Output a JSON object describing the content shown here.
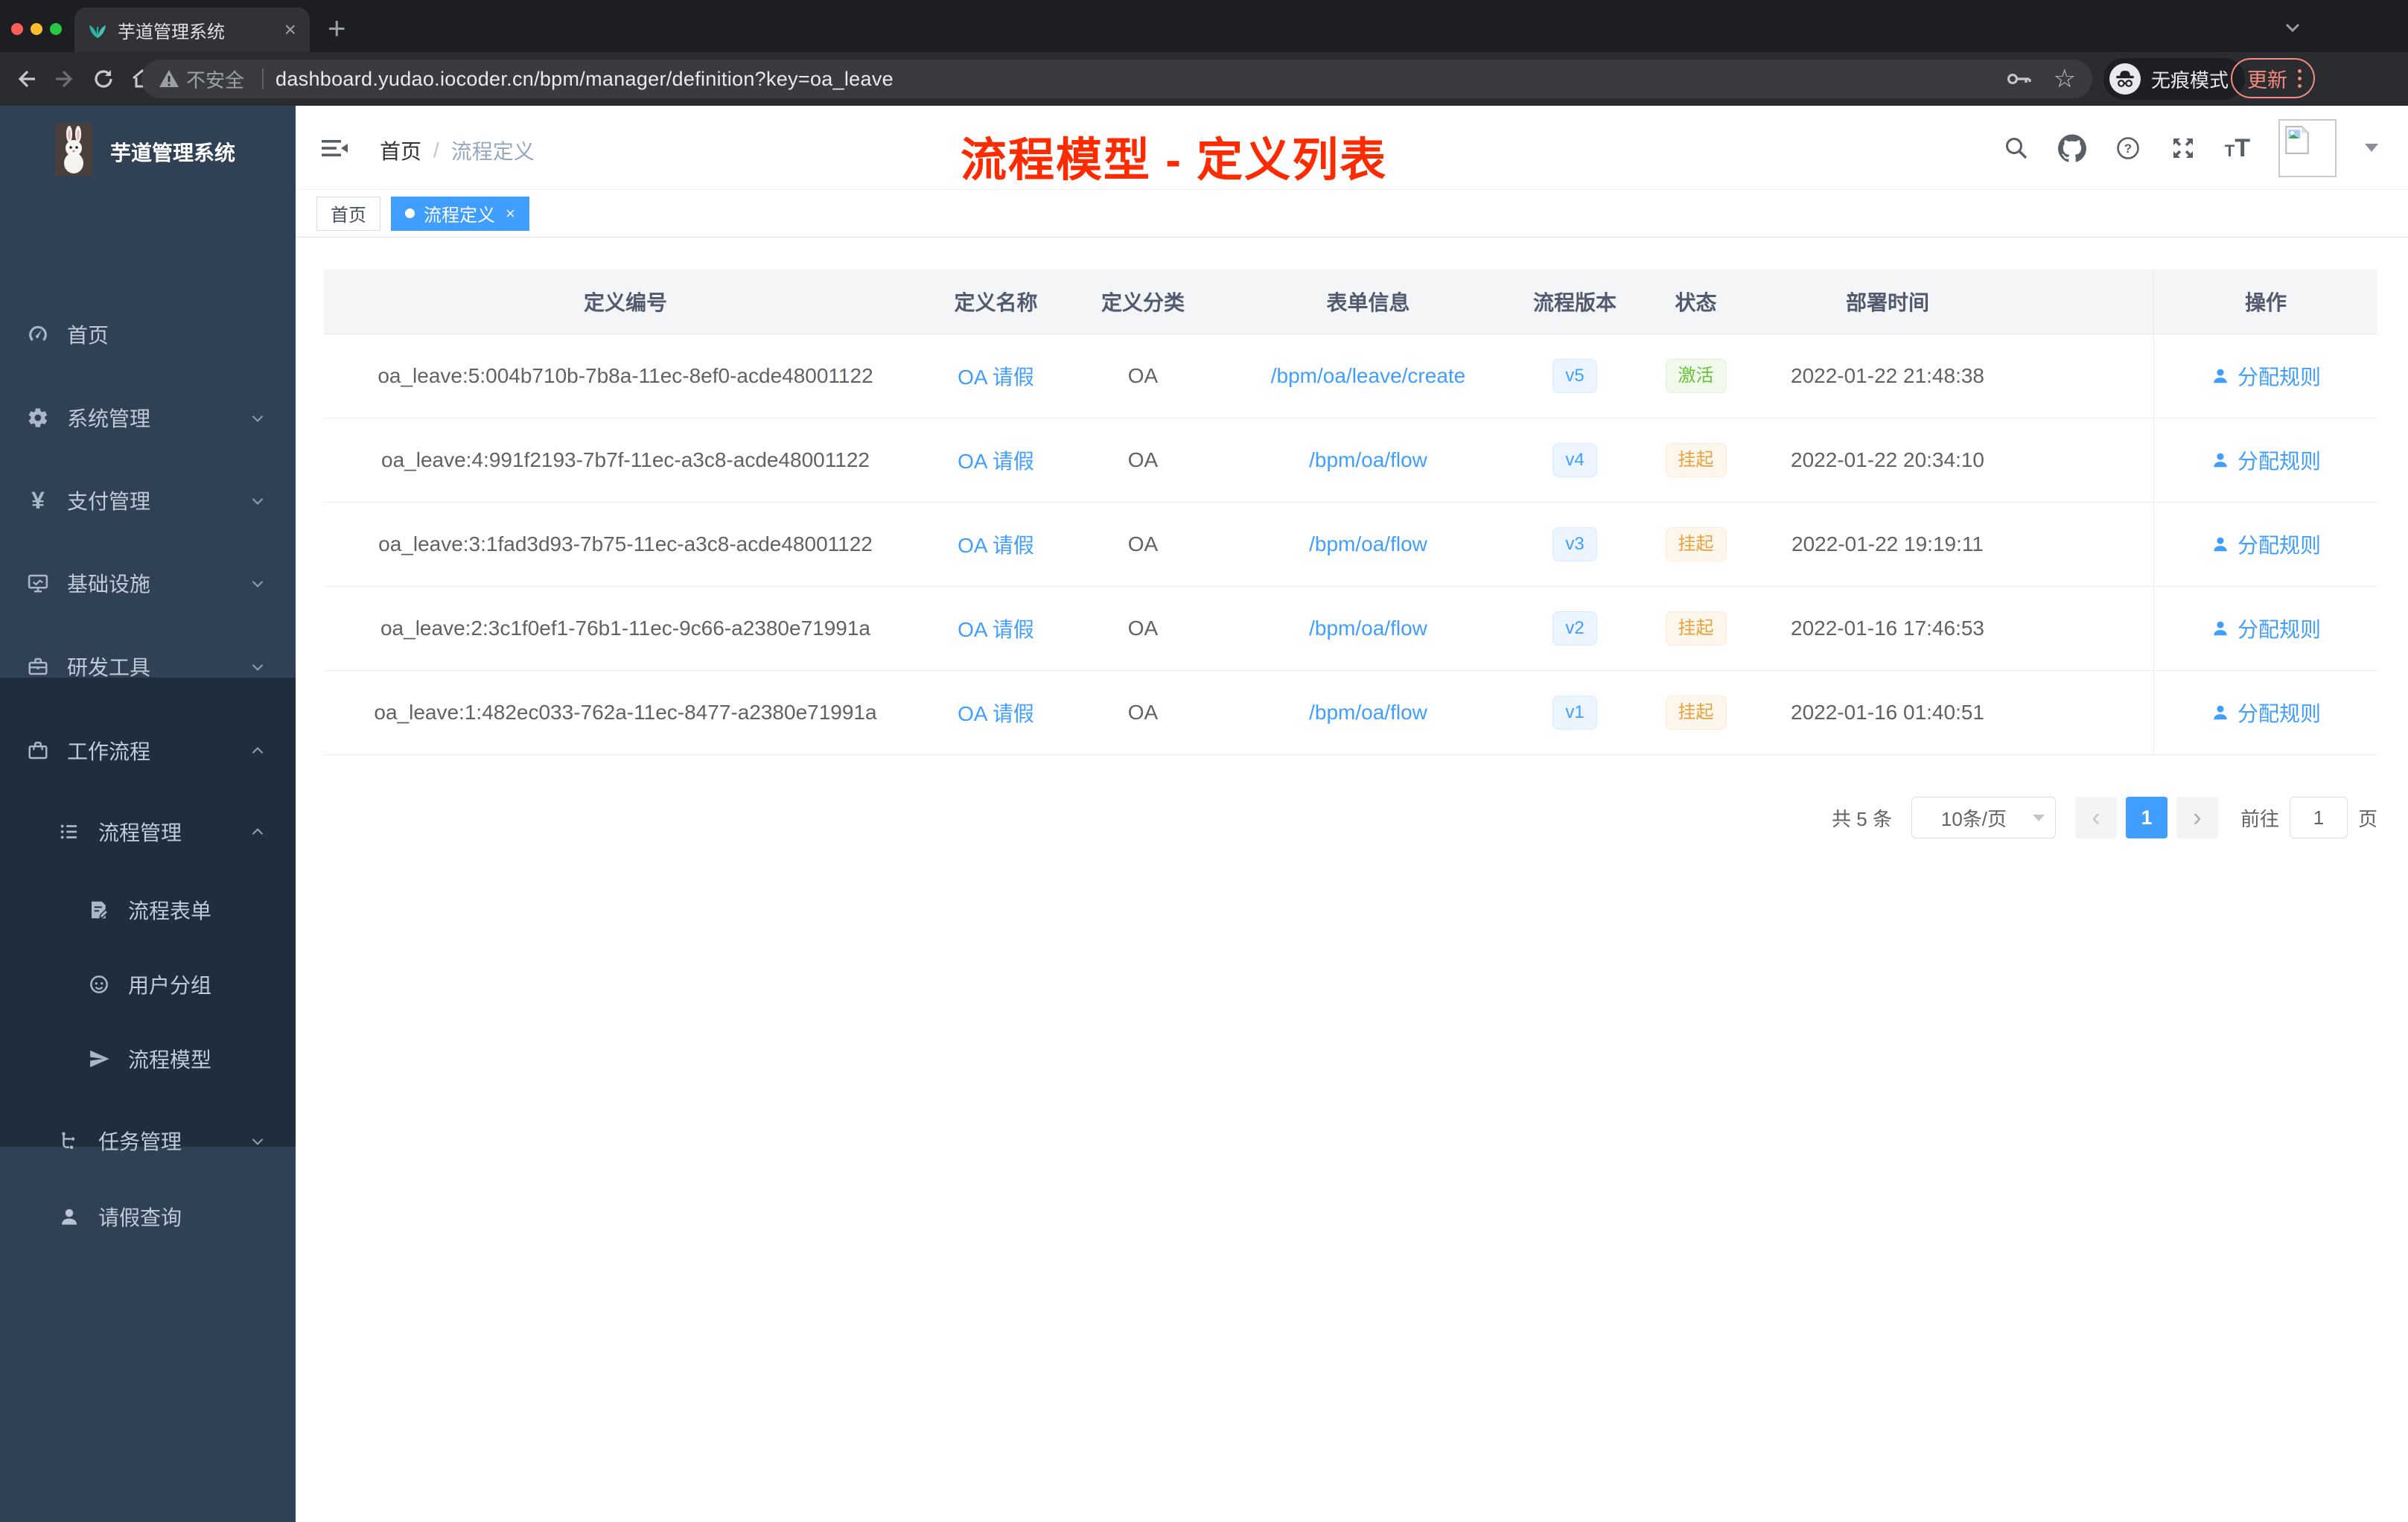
{
  "colors": {
    "accent": "#409eff",
    "status_active_text": "#67c23a",
    "status_suspended_text": "#e6a23c",
    "annotation_red": "#ff2b00",
    "sidebar_bg": "#304156",
    "submenu_bg": "#1f2d3d"
  },
  "browser": {
    "tab_title": "芋道管理系统",
    "security_label": "不安全",
    "url": "dashboard.yudao.iocoder.cn/bpm/manager/definition?key=oa_leave",
    "incognito_label": "无痕模式",
    "update_label": "更新"
  },
  "sidebar": {
    "app_title": "芋道管理系统",
    "items": [
      {
        "label": "首页",
        "icon": "dashboard-icon"
      },
      {
        "label": "系统管理",
        "icon": "gear-icon",
        "chevron": "down"
      },
      {
        "label": "支付管理",
        "icon": "yen-icon",
        "chevron": "down"
      },
      {
        "label": "基础设施",
        "icon": "monitor-icon",
        "chevron": "down"
      },
      {
        "label": "研发工具",
        "icon": "toolbox-icon",
        "chevron": "down"
      },
      {
        "label": "工作流程",
        "icon": "briefcase-icon",
        "chevron": "up"
      },
      {
        "label": "流程管理",
        "icon": "workflow-list-icon",
        "chevron": "up"
      },
      {
        "label": "流程表单",
        "icon": "form-icon"
      },
      {
        "label": "用户分组",
        "icon": "user-group-icon"
      },
      {
        "label": "流程模型",
        "icon": "paper-plane-icon"
      },
      {
        "label": "任务管理",
        "icon": "task-tree-icon",
        "chevron": "down"
      },
      {
        "label": "请假查询",
        "icon": "person-icon"
      }
    ]
  },
  "header": {
    "breadcrumb": {
      "home": "首页",
      "separator": "/",
      "current": "流程定义"
    },
    "annotation": "流程模型 - 定义列表"
  },
  "tags": {
    "home": "首页",
    "active_tab": "流程定义",
    "close": "×"
  },
  "table": {
    "columns": [
      "定义编号",
      "定义名称",
      "定义分类",
      "表单信息",
      "流程版本",
      "状态",
      "部署时间",
      "操作"
    ],
    "rows": [
      {
        "id": "oa_leave:5:004b710b-7b8a-11ec-8ef0-acde48001122",
        "name": "OA 请假",
        "category": "OA",
        "form": "/bpm/oa/leave/create",
        "version": "v5",
        "status": "激活",
        "status_type": "active",
        "deploy_time": "2022-01-22 21:48:38",
        "action": "分配规则"
      },
      {
        "id": "oa_leave:4:991f2193-7b7f-11ec-a3c8-acde48001122",
        "name": "OA 请假",
        "category": "OA",
        "form": "/bpm/oa/flow",
        "version": "v4",
        "status": "挂起",
        "status_type": "suspended",
        "deploy_time": "2022-01-22 20:34:10",
        "action": "分配规则"
      },
      {
        "id": "oa_leave:3:1fad3d93-7b75-11ec-a3c8-acde48001122",
        "name": "OA 请假",
        "category": "OA",
        "form": "/bpm/oa/flow",
        "version": "v3",
        "status": "挂起",
        "status_type": "suspended",
        "deploy_time": "2022-01-22 19:19:11",
        "action": "分配规则"
      },
      {
        "id": "oa_leave:2:3c1f0ef1-76b1-11ec-9c66-a2380e71991a",
        "name": "OA 请假",
        "category": "OA",
        "form": "/bpm/oa/flow",
        "version": "v2",
        "status": "挂起",
        "status_type": "suspended",
        "deploy_time": "2022-01-16 17:46:53",
        "action": "分配规则"
      },
      {
        "id": "oa_leave:1:482ec033-762a-11ec-8477-a2380e71991a",
        "name": "OA 请假",
        "category": "OA",
        "form": "/bpm/oa/flow",
        "version": "v1",
        "status": "挂起",
        "status_type": "suspended",
        "deploy_time": "2022-01-16 01:40:51",
        "action": "分配规则"
      }
    ]
  },
  "pagination": {
    "total": "共 5 条",
    "page_size": "10条/页",
    "prev": "‹",
    "current_page": "1",
    "next": "›",
    "goto_label": "前往",
    "goto_value": "1",
    "unit": "页"
  }
}
